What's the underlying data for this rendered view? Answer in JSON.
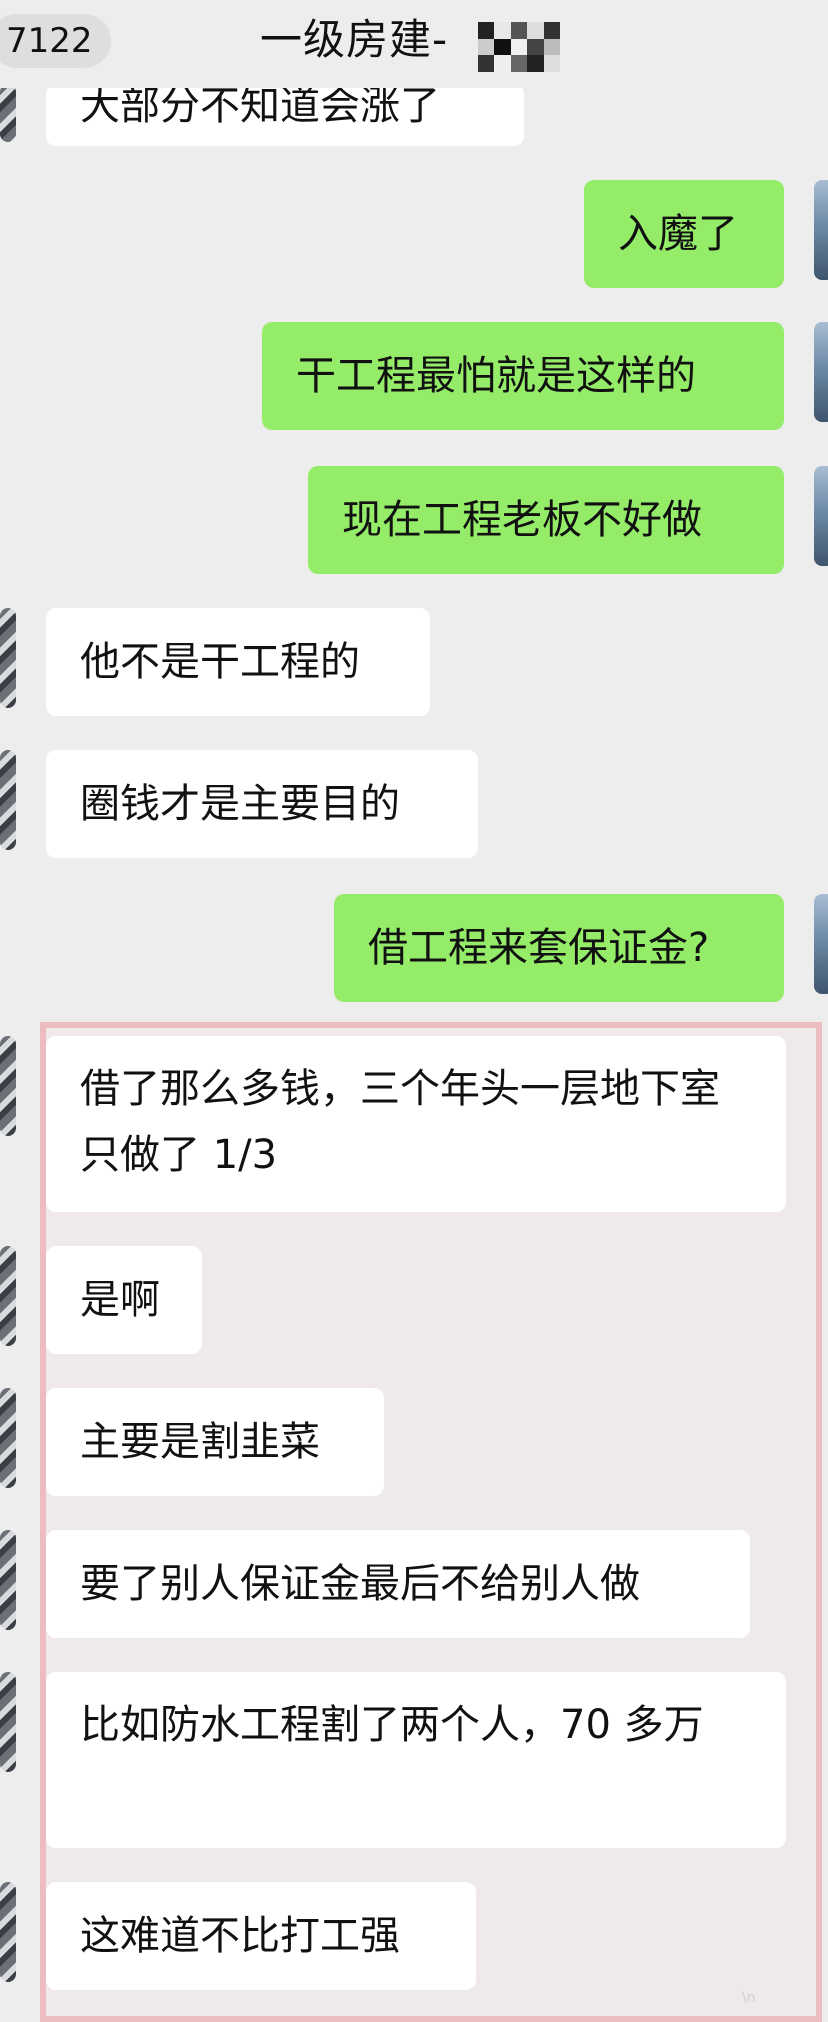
{
  "header": {
    "badge": "7122",
    "title": "一级房建-"
  },
  "messages": [
    {
      "from": "in",
      "text": "大部分不知道会涨了"
    },
    {
      "from": "out",
      "text": "入魔了"
    },
    {
      "from": "out",
      "text": "干工程最怕就是这样的"
    },
    {
      "from": "out",
      "text": "现在工程老板不好做"
    },
    {
      "from": "in",
      "text": "他不是干工程的"
    },
    {
      "from": "in",
      "text": "圈钱才是主要目的"
    },
    {
      "from": "out",
      "text": "借工程来套保证金?"
    },
    {
      "from": "in",
      "text": "借了那么多钱，三个年头一层地下室只做了 1/3"
    },
    {
      "from": "in",
      "text": "是啊"
    },
    {
      "from": "in",
      "text": "主要是割韭菜"
    },
    {
      "from": "in",
      "text": "要了别人保证金最后不给别人做"
    },
    {
      "from": "in",
      "text": "比如防水工程割了两个人，70 多万"
    },
    {
      "from": "in",
      "text": "这难道不比打工强"
    }
  ],
  "colors": {
    "background": "#ededed",
    "incoming_bubble": "#ffffff",
    "outgoing_bubble": "#95ec69",
    "highlight_border": "#ecb4ba"
  }
}
